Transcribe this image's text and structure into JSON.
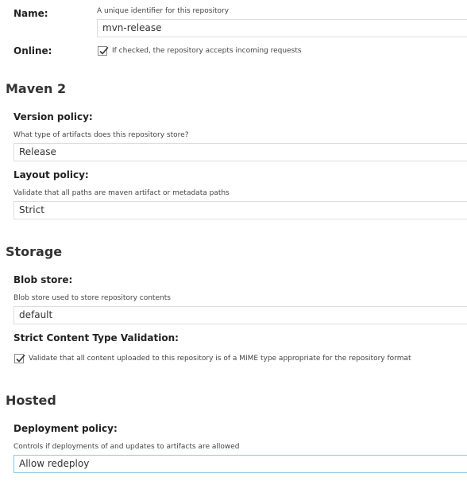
{
  "name_field": {
    "label": "Name:",
    "help": "A unique identifier for this repository",
    "value": "mvn-release"
  },
  "online_field": {
    "label": "Online:",
    "checked": true,
    "checkbox_label": "If checked, the repository accepts incoming requests"
  },
  "maven": {
    "title": "Maven 2",
    "version_policy": {
      "label": "Version policy:",
      "help": "What type of artifacts does this repository store?",
      "value": "Release"
    },
    "layout_policy": {
      "label": "Layout policy:",
      "help": "Validate that all paths are maven artifact or metadata paths",
      "value": "Strict"
    }
  },
  "storage": {
    "title": "Storage",
    "blob_store": {
      "label": "Blob store:",
      "help": "Blob store used to store repository contents",
      "value": "default"
    },
    "strict_validation": {
      "label": "Strict Content Type Validation:",
      "checked": true,
      "checkbox_label": "Validate that all content uploaded to this repository is of a MIME type appropriate for the repository format"
    }
  },
  "hosted": {
    "title": "Hosted",
    "deployment_policy": {
      "label": "Deployment policy:",
      "help": "Controls if deployments of and updates to artifacts are allowed",
      "value": "Allow redeploy"
    }
  },
  "colors": {
    "input_border": "#dddddd",
    "focus_border": "#8cc9e3",
    "text": "#333333"
  }
}
